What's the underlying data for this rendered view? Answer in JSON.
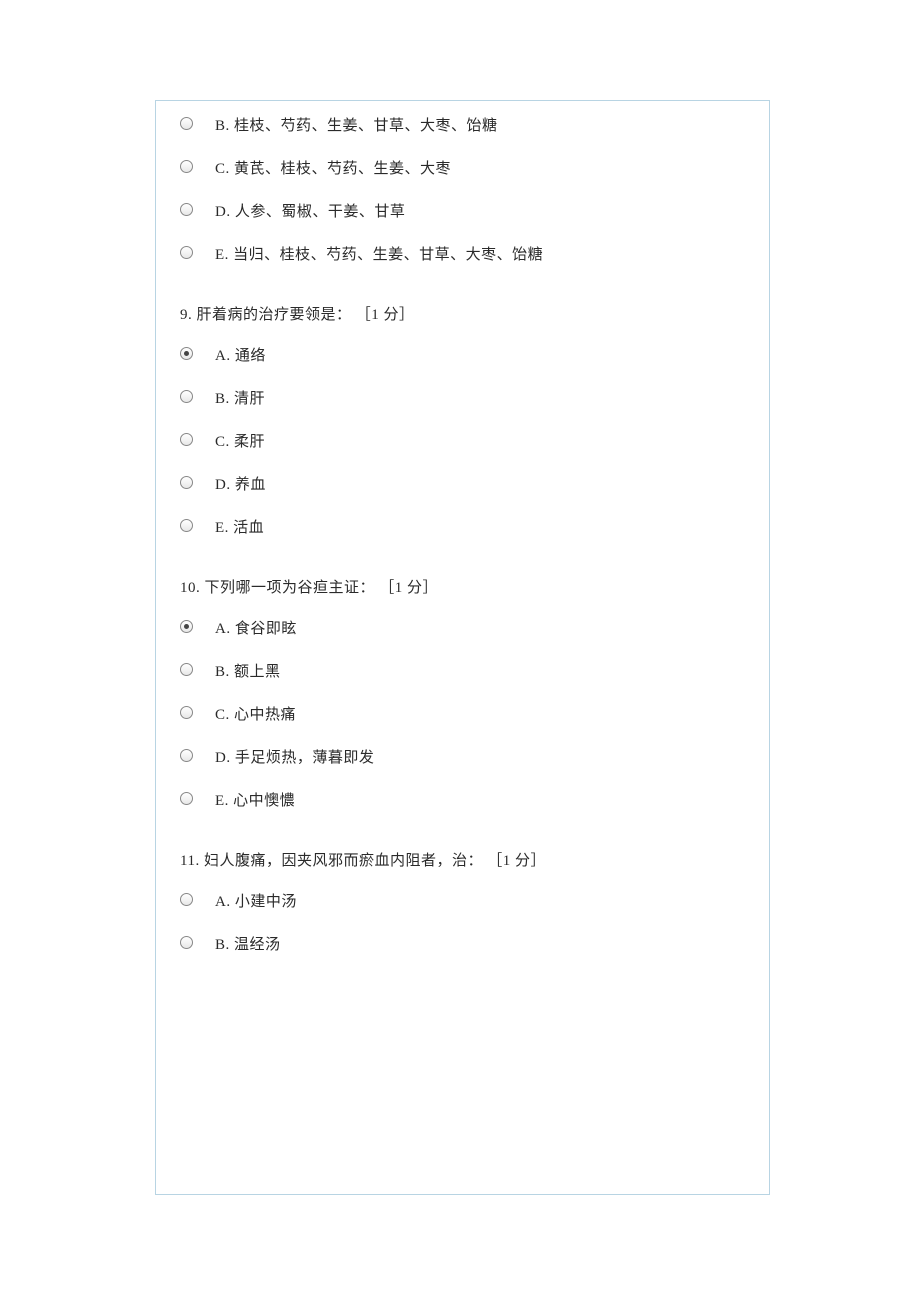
{
  "q8_remaining_options": [
    {
      "key": "B",
      "text": "B. 桂枝、芍药、生姜、甘草、大枣、饴糖",
      "selected": false
    },
    {
      "key": "C",
      "text": "C. 黄芪、桂枝、芍药、生姜、大枣",
      "selected": false
    },
    {
      "key": "D",
      "text": "D. 人参、蜀椒、干姜、甘草",
      "selected": false
    },
    {
      "key": "E",
      "text": "E. 当归、桂枝、芍药、生姜、甘草、大枣、饴糖",
      "selected": false
    }
  ],
  "questions": [
    {
      "number": "9.",
      "title": "肝着病的治疗要领是：",
      "points": "［1 分］",
      "options": [
        {
          "key": "A",
          "text": "A. 通络",
          "selected": true
        },
        {
          "key": "B",
          "text": "B. 清肝",
          "selected": false
        },
        {
          "key": "C",
          "text": "C. 柔肝",
          "selected": false
        },
        {
          "key": "D",
          "text": "D. 养血",
          "selected": false
        },
        {
          "key": "E",
          "text": "E. 活血",
          "selected": false
        }
      ]
    },
    {
      "number": "10.",
      "title": "下列哪一项为谷疸主证：",
      "points": "［1 分］",
      "options": [
        {
          "key": "A",
          "text": "A. 食谷即眩",
          "selected": true
        },
        {
          "key": "B",
          "text": "B. 额上黑",
          "selected": false
        },
        {
          "key": "C",
          "text": "C. 心中热痛",
          "selected": false
        },
        {
          "key": "D",
          "text": "D. 手足烦热，薄暮即发",
          "selected": false
        },
        {
          "key": "E",
          "text": "E. 心中懊憹",
          "selected": false
        }
      ]
    },
    {
      "number": "11.",
      "title": "妇人腹痛，因夹风邪而瘀血内阻者，治：",
      "points": "［1 分］",
      "options": [
        {
          "key": "A",
          "text": "A. 小建中汤",
          "selected": false
        },
        {
          "key": "B",
          "text": "B. 温经汤",
          "selected": false
        }
      ]
    }
  ]
}
